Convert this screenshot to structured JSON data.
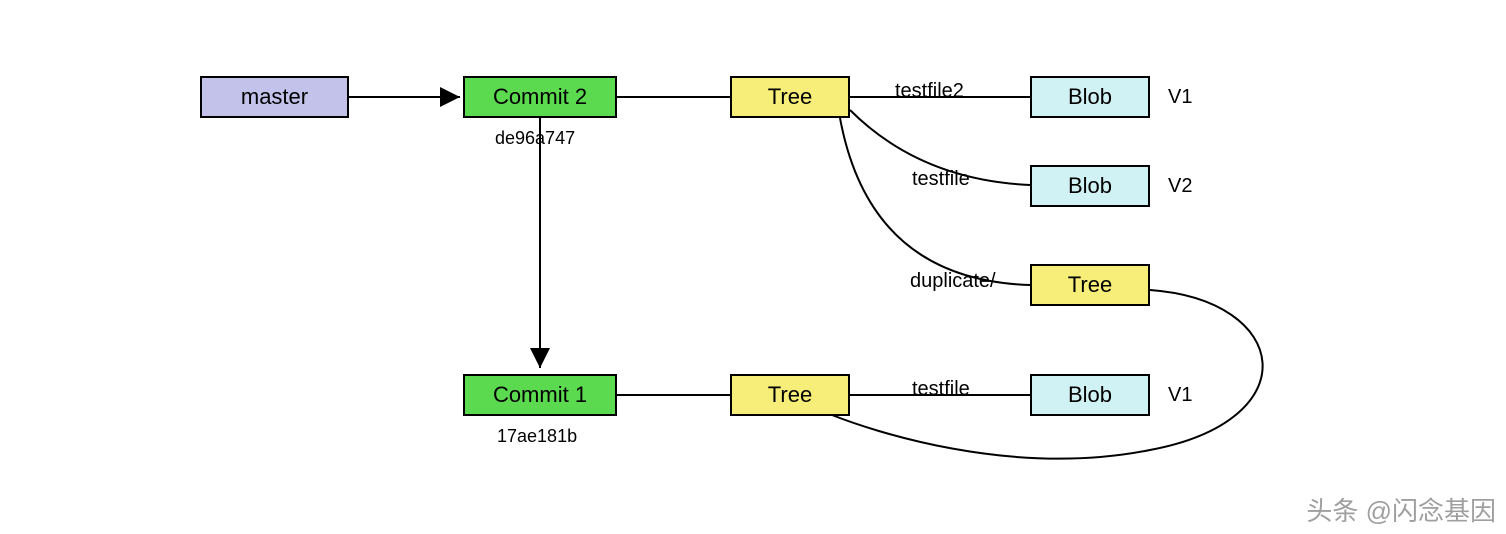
{
  "nodes": {
    "master": {
      "label": "master"
    },
    "commit2": {
      "label": "Commit 2",
      "hash": "de96a747"
    },
    "commit1": {
      "label": "Commit 1",
      "hash": "17ae181b"
    },
    "tree_top": {
      "label": "Tree"
    },
    "tree_dup": {
      "label": "Tree"
    },
    "tree_bot": {
      "label": "Tree"
    },
    "blob1": {
      "label": "Blob",
      "version": "V1"
    },
    "blob2": {
      "label": "Blob",
      "version": "V2"
    },
    "blob3": {
      "label": "Blob",
      "version": "V1"
    }
  },
  "edge_labels": {
    "testfile2": "testfile2",
    "testfile_mid": "testfile",
    "duplicate": "duplicate/",
    "testfile_bot": "testfile"
  },
  "watermark": "头条 @闪念基因"
}
